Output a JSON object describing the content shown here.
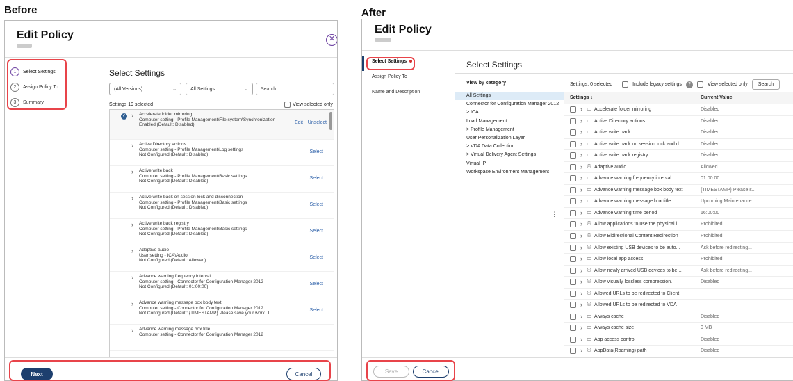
{
  "before": {
    "heading": "Before",
    "title": "Edit Policy",
    "steps": [
      {
        "num": "1",
        "label": "Select Settings"
      },
      {
        "num": "2",
        "label": "Assign Policy To"
      },
      {
        "num": "3",
        "label": "Summary"
      }
    ],
    "section_title": "Select Settings",
    "version_select": "(All Versions)",
    "settings_select": "All Settings",
    "search_placeholder": "Search",
    "selected_count": "Settings 19 selected",
    "view_selected": "View selected only",
    "settings": [
      {
        "name": "Accelerate folder mirroring",
        "path": "Computer setting - Profile Management\\File system\\Synchronization",
        "status": "Enabled (Default: Disabled)",
        "checked": true
      },
      {
        "name": "Active Directory actions",
        "path": "Computer setting - Profile Management\\Log settings",
        "status": "Not Configured (Default: Disabled)",
        "checked": false
      },
      {
        "name": "Active write back",
        "path": "Computer setting - Profile Management\\Basic settings",
        "status": "Not Configured (Default: Disabled)",
        "checked": false
      },
      {
        "name": "Active write back on session lock and disconnection",
        "path": "Computer setting - Profile Management\\Basic settings",
        "status": "Not Configured (Default: Disabled)",
        "checked": false
      },
      {
        "name": "Active write back registry",
        "path": "Computer setting - Profile Management\\Basic settings",
        "status": "Not Configured (Default: Disabled)",
        "checked": false
      },
      {
        "name": "Adaptive audio",
        "path": "User setting - ICA\\Audio",
        "status": "Not Configured (Default: Allowed)",
        "checked": false
      },
      {
        "name": "Advance warning frequency interval",
        "path": "Computer setting - Connector for Configuration Manager 2012",
        "status": "Not Configured (Default: 01:00:00)",
        "checked": false
      },
      {
        "name": "Advance warning message box body text",
        "path": "Computer setting - Connector for Configuration Manager 2012",
        "status": "Not Configured (Default: {TIMESTAMP} Please save your work. T...",
        "checked": false
      },
      {
        "name": "Advance warning message box title",
        "path": "Computer setting - Connector for Configuration Manager 2012",
        "status": "",
        "checked": false
      }
    ],
    "edit_label": "Edit",
    "unselect_label": "Unselect",
    "select_label": "Select",
    "next_label": "Next",
    "cancel_label": "Cancel"
  },
  "after": {
    "heading": "After",
    "title": "Edit Policy",
    "nav": [
      {
        "label": "Select Settings",
        "active": true
      },
      {
        "label": "Assign Policy To",
        "active": false
      },
      {
        "label": "Name and Description",
        "active": false
      }
    ],
    "section_title": "Select Settings",
    "view_by": "View by category",
    "categories": [
      "All Settings",
      "Connector for Configuration Manager 2012",
      "> ICA",
      "Load Management",
      "> Profile Management",
      "User Personalization Layer",
      "> VDA Data Collection",
      "> Virtual Delivery Agent Settings",
      "Virtual IP",
      "Workspace Environment Management"
    ],
    "selected_count": "Settings: 0 selected",
    "include_legacy": "Include legacy settings",
    "view_selected": "View selected only",
    "search_placeholder": "Search",
    "col_settings": "Settings ↓",
    "col_value": "Current Value",
    "rows": [
      {
        "icon": "monitor",
        "name": "Accelerate folder mirroring",
        "value": "Disabled"
      },
      {
        "icon": "monitor",
        "name": "Active Directory actions",
        "value": "Disabled"
      },
      {
        "icon": "monitor",
        "name": "Active write back",
        "value": "Disabled"
      },
      {
        "icon": "monitor",
        "name": "Active write back on session lock and d...",
        "value": "Disabled"
      },
      {
        "icon": "monitor",
        "name": "Active write back registry",
        "value": "Disabled"
      },
      {
        "icon": "user",
        "name": "Adaptive audio",
        "value": "Allowed"
      },
      {
        "icon": "monitor",
        "name": "Advance warning frequency interval",
        "value": "01:00:00"
      },
      {
        "icon": "monitor",
        "name": "Advance warning message box body text",
        "value": "{TIMESTAMP} Please s..."
      },
      {
        "icon": "monitor",
        "name": "Advance warning message box title",
        "value": "Upcoming Maintenance"
      },
      {
        "icon": "monitor",
        "name": "Advance warning time period",
        "value": "16:00:00"
      },
      {
        "icon": "user",
        "name": "Allow applications to use the physical l...",
        "value": "Prohibited"
      },
      {
        "icon": "user",
        "name": "Allow Bidirectional Content Redirection",
        "value": "Prohibited"
      },
      {
        "icon": "user",
        "name": "Allow existing USB devices to be auto...",
        "value": "Ask before redirecting..."
      },
      {
        "icon": "monitor",
        "name": "Allow local app access",
        "value": "Prohibited"
      },
      {
        "icon": "user",
        "name": "Allow newly arrived USB devices to be ...",
        "value": "Ask before redirecting..."
      },
      {
        "icon": "user",
        "name": "Allow visually lossless compression.",
        "value": "Disabled"
      },
      {
        "icon": "user",
        "name": "Allowed URLs to be redirected to Client",
        "value": ""
      },
      {
        "icon": "user",
        "name": "Allowed URLs to be redirected to VDA",
        "value": ""
      },
      {
        "icon": "monitor",
        "name": "Always cache",
        "value": "Disabled"
      },
      {
        "icon": "monitor",
        "name": "Always cache size",
        "value": "0 MB"
      },
      {
        "icon": "monitor",
        "name": "App access control",
        "value": "Disabled"
      },
      {
        "icon": "user",
        "name": "AppData(Roaming) path",
        "value": "Disabled"
      }
    ],
    "save_label": "Save",
    "cancel_label": "Cancel"
  }
}
